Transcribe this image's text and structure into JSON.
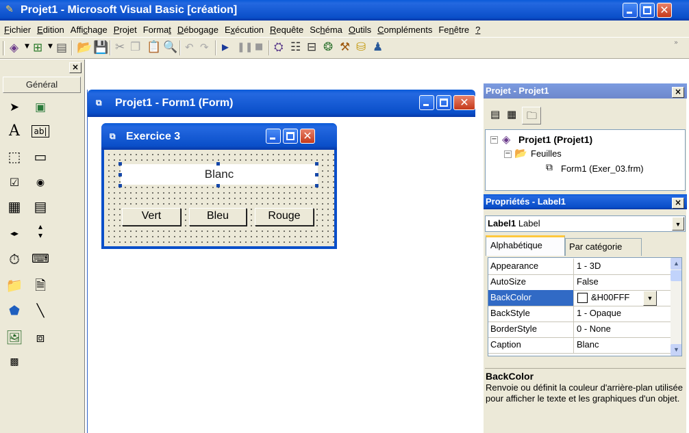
{
  "main_window": {
    "title": "Projet1 - Microsoft Visual Basic [création]"
  },
  "menu": [
    {
      "pre": "",
      "u": "F",
      "post": "ichier"
    },
    {
      "pre": "",
      "u": "E",
      "post": "dition"
    },
    {
      "pre": "Affi",
      "u": "c",
      "post": "hage"
    },
    {
      "pre": "",
      "u": "P",
      "post": "rojet"
    },
    {
      "pre": "Forma",
      "u": "t",
      "post": ""
    },
    {
      "pre": "",
      "u": "D",
      "post": "ébogage"
    },
    {
      "pre": "E",
      "u": "x",
      "post": "écution"
    },
    {
      "pre": "",
      "u": "R",
      "post": "equête"
    },
    {
      "pre": "Sc",
      "u": "h",
      "post": "éma"
    },
    {
      "pre": "",
      "u": "O",
      "post": "utils"
    },
    {
      "pre": "",
      "u": "C",
      "post": "ompléments"
    },
    {
      "pre": "Fe",
      "u": "n",
      "post": "être"
    },
    {
      "pre": "",
      "u": "?",
      "post": ""
    }
  ],
  "toolbox": {
    "tab_label": "Général"
  },
  "form_container": {
    "title": "Projet1 - Form1 (Form)"
  },
  "form": {
    "title": "Exercice 3",
    "label_caption": "Blanc",
    "buttons": [
      "Vert",
      "Bleu",
      "Rouge"
    ]
  },
  "project_explorer": {
    "title": "Projet - Projet1",
    "root": "Projet1 (Projet1)",
    "folder": "Feuilles",
    "item": "Form1 (Exer_03.frm)"
  },
  "properties": {
    "title": "Propriétés - Label1",
    "object_name": "Label1",
    "object_type": "Label",
    "tabs": [
      "Alphabétique",
      "Par catégorie"
    ],
    "rows": [
      {
        "name": "Appearance",
        "value": "1 - 3D"
      },
      {
        "name": "AutoSize",
        "value": "False"
      },
      {
        "name": "BackColor",
        "value": "&H00FFF"
      },
      {
        "name": "BackStyle",
        "value": "1 - Opaque"
      },
      {
        "name": "BorderStyle",
        "value": "0 - None"
      },
      {
        "name": "Caption",
        "value": "Blanc"
      }
    ],
    "selected_row": "BackColor",
    "desc_title": "BackColor",
    "desc_text": "Renvoie ou définit la couleur d'arrière-plan utilisée pour afficher le texte et les graphiques d'un objet."
  },
  "colors": {
    "xp_blue": "#0a4fc9",
    "face": "#ece9d8",
    "selection": "#316ac5"
  }
}
